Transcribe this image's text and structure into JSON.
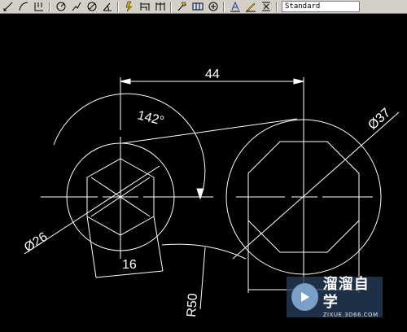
{
  "toolbar": {
    "icons": [
      "dimension-linear-icon",
      "dimension-arc-icon",
      "dimension-ordinate-icon",
      "dimension-radius-icon",
      "dimension-jogged-icon",
      "dimension-diameter-icon",
      "dimension-angular-icon",
      "quick-dimension-icon",
      "baseline-dimension-icon",
      "continue-dimension-icon",
      "quick-leader-icon",
      "tolerance-icon",
      "center-mark-icon",
      "dimension-edit-icon",
      "dimension-text-edit-icon",
      "dimension-update-icon"
    ],
    "dim_style": "Standard"
  },
  "drawing": {
    "dimensions": {
      "center_distance": "44",
      "angle": "142°",
      "left_diameter": "Ø26",
      "right_diameter": "Ø37",
      "hex_width": "16",
      "radius": "R50"
    }
  },
  "watermark": {
    "name": "溜溜自学",
    "url": "ZIXUE.3D66.COM"
  }
}
